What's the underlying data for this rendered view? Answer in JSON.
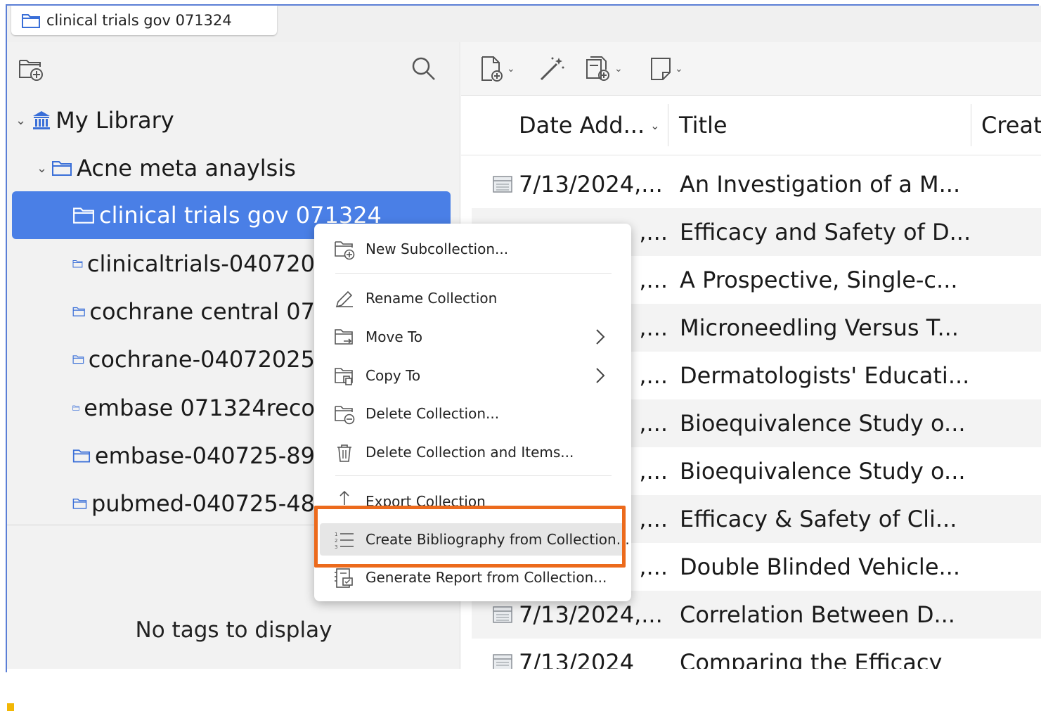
{
  "tab": {
    "title": "clinical trials gov 071324"
  },
  "library": {
    "root": "My Library",
    "parent": "Acne meta anaylsis",
    "collections": [
      "clinical trials gov 071324",
      "clinicaltrials-040720",
      "cochrane central 07",
      "cochrane-04072025",
      "embase 071324reco",
      "embase-040725-89",
      "pubmed-040725-48"
    ]
  },
  "tags": {
    "empty_text": "No tags to display"
  },
  "columns": {
    "date": "Date Add...",
    "title": "Title",
    "creator": "Creat"
  },
  "rows": [
    {
      "date": "7/13/2024,...",
      "title": "An Investigation of a M..."
    },
    {
      "date": ",...",
      "title": "Efficacy and Safety of D..."
    },
    {
      "date": ",...",
      "title": "A Prospective, Single-c..."
    },
    {
      "date": ",...",
      "title": "Microneedling Versus T..."
    },
    {
      "date": ",...",
      "title": "Dermatologists' Educati..."
    },
    {
      "date": ",...",
      "title": "Bioequivalence Study o..."
    },
    {
      "date": ",...",
      "title": "Bioequivalence Study o..."
    },
    {
      "date": ",...",
      "title": "Efficacy & Safety of Cli..."
    },
    {
      "date": ",...",
      "title": "Double Blinded Vehicle..."
    },
    {
      "date": "7/13/2024,...",
      "title": "Correlation Between D..."
    },
    {
      "date": "7/13/2024",
      "title": "Comparing the Efficacy"
    }
  ],
  "context_menu": {
    "new_subcollection": "New Subcollection...",
    "rename": "Rename Collection",
    "move_to": "Move To",
    "copy_to": "Copy To",
    "delete": "Delete Collection...",
    "delete_items": "Delete Collection and Items...",
    "export": "Export Collection",
    "create_bibliography": "Create Bibliography from Collection...",
    "generate_report": "Generate Report from Collection..."
  },
  "colors": {
    "selection": "#4a7fe6",
    "highlight": "#ec6a1c",
    "border": "#5b7fd6"
  }
}
